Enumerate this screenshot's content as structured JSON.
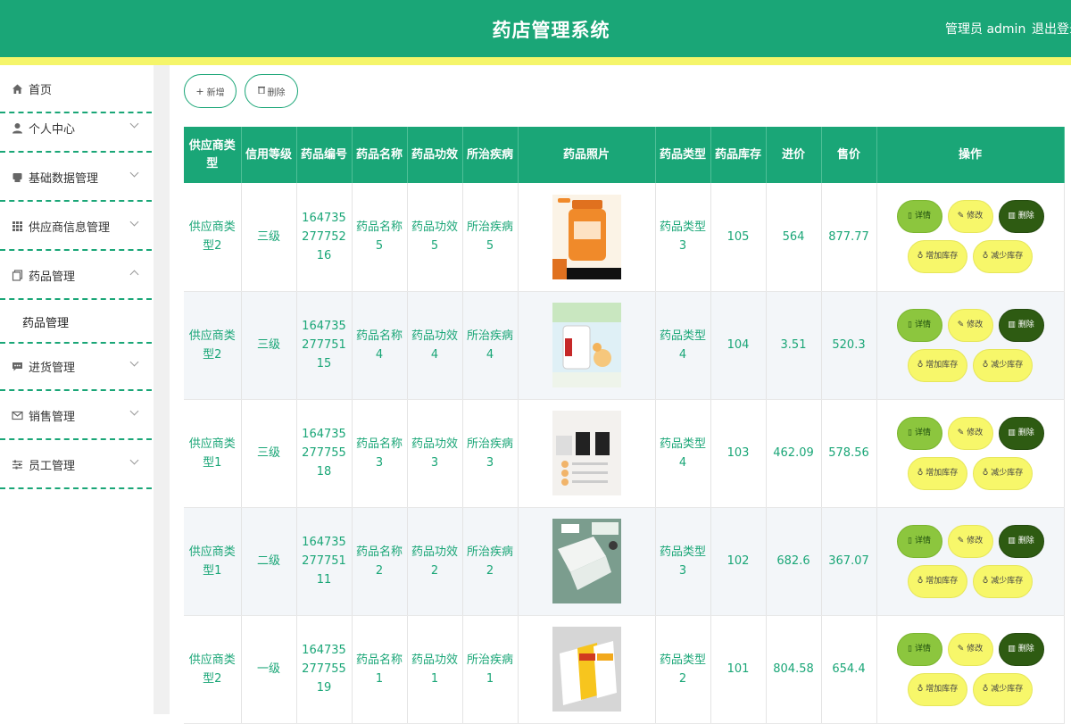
{
  "header": {
    "title": "药店管理系统",
    "admin_label": "管理员 admin",
    "logout_label": "退出登录"
  },
  "sidebar": {
    "items": [
      {
        "label": "首页",
        "icon": "home-icon"
      },
      {
        "label": "个人中心",
        "icon": "user-icon"
      },
      {
        "label": "基础数据管理",
        "icon": "box-icon"
      },
      {
        "label": "供应商信息管理",
        "icon": "grid-icon"
      },
      {
        "label": "药品管理",
        "icon": "copy-icon"
      },
      {
        "label": "进货管理",
        "icon": "message-icon"
      },
      {
        "label": "销售管理",
        "icon": "mail-icon"
      },
      {
        "label": "员工管理",
        "icon": "sliders-icon"
      }
    ],
    "sub_item": "药品管理"
  },
  "toolbar": {
    "add_label": "新增",
    "delete_label": "删除"
  },
  "table": {
    "columns": [
      "供应商类型",
      "信用等级",
      "药品编号",
      "药品名称",
      "药品功效",
      "所治疾病",
      "药品照片",
      "药品类型",
      "药品库存",
      "进价",
      "售价",
      "操作"
    ],
    "rows": [
      {
        "supplier_type": "供应商类型2",
        "credit": "三级",
        "code": "16473527775216",
        "name": "药品名称5",
        "effect": "药品功效5",
        "disease": "所治疾病5",
        "photo": "orange-bottle",
        "type": "药品类型3",
        "stock": "105",
        "cost": "564",
        "price": "877.77"
      },
      {
        "supplier_type": "供应商类型2",
        "credit": "三级",
        "code": "16473527775115",
        "name": "药品名称4",
        "effect": "药品功效4",
        "disease": "所治疾病4",
        "photo": "white-jar",
        "type": "药品类型4",
        "stock": "104",
        "cost": "3.51",
        "price": "520.3"
      },
      {
        "supplier_type": "供应商类型1",
        "credit": "三级",
        "code": "16473527775518",
        "name": "药品名称3",
        "effect": "药品功效3",
        "disease": "所治疾病3",
        "photo": "supplement-ad",
        "type": "药品类型4",
        "stock": "103",
        "cost": "462.09",
        "price": "578.56"
      },
      {
        "supplier_type": "供应商类型1",
        "credit": "二级",
        "code": "16473527775111",
        "name": "药品名称2",
        "effect": "药品功效2",
        "disease": "所治疾病2",
        "photo": "green-boxes",
        "type": "药品类型3",
        "stock": "102",
        "cost": "682.6",
        "price": "367.07"
      },
      {
        "supplier_type": "供应商类型2",
        "credit": "一级",
        "code": "16473527775519",
        "name": "药品名称1",
        "effect": "药品功效1",
        "disease": "所治疾病1",
        "photo": "yellow-boxes",
        "type": "药品类型2",
        "stock": "101",
        "cost": "804.58",
        "price": "654.4"
      }
    ],
    "actions": {
      "detail": "详情",
      "edit": "修改",
      "delete": "删除",
      "add_stock": "增加库存",
      "reduce_stock": "减少库存"
    }
  },
  "colors": {
    "primary": "#1aa677",
    "accent_yellow": "#f5f56a",
    "detail_green": "#8cc63e",
    "delete_dark": "#2e5b12"
  }
}
